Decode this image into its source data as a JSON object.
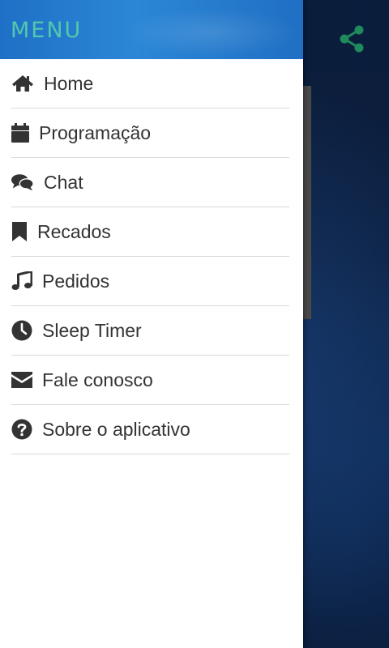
{
  "drawer": {
    "title": "MENU",
    "items": [
      {
        "label": "Home",
        "icon": "home-icon"
      },
      {
        "label": "Programação",
        "icon": "calendar-icon"
      },
      {
        "label": "Chat",
        "icon": "chat-icon"
      },
      {
        "label": "Recados",
        "icon": "bookmark-icon"
      },
      {
        "label": "Pedidos",
        "icon": "music-note-icon"
      },
      {
        "label": "Sleep Timer",
        "icon": "clock-icon"
      },
      {
        "label": "Fale conosco",
        "icon": "envelope-icon"
      },
      {
        "label": "Sobre o aplicativo",
        "icon": "question-circle-icon"
      }
    ]
  },
  "background": {
    "header_icon": "share-icon"
  },
  "colors": {
    "drawer_header": "#2a80d2",
    "drawer_title": "#52c7ad",
    "menu_text": "#333333",
    "divider": "#d9d9d9",
    "background_app": "#0b1a33",
    "share_icon": "#1f8a5b"
  }
}
